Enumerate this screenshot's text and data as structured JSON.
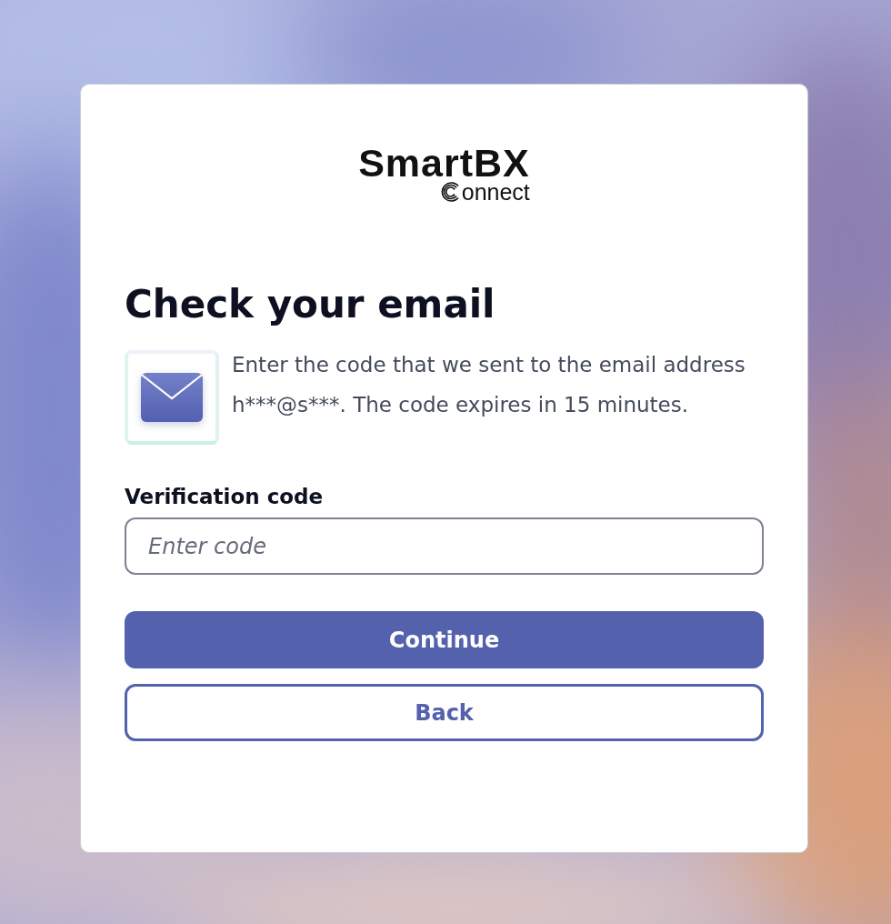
{
  "logo": {
    "name": "SmartBX",
    "subtitle": "onnect"
  },
  "title": "Check your email",
  "message": "Enter the code that we sent to the email address h***@s***. The code expires in 15 minutes.",
  "field": {
    "label": "Verification code",
    "placeholder": "Enter code"
  },
  "buttons": [
    {
      "label": "Continue",
      "kind": "primary"
    },
    {
      "label": "Back",
      "kind": "secondary"
    }
  ]
}
